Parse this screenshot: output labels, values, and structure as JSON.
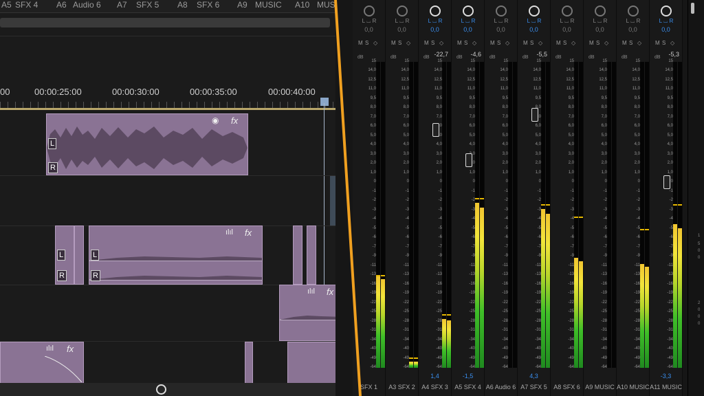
{
  "timeline": {
    "track_tabs": [
      {
        "num": "A5",
        "name": "SFX 4"
      },
      {
        "num": "A6",
        "name": "Audio 6"
      },
      {
        "num": "A7",
        "name": "SFX 5"
      },
      {
        "num": "A8",
        "name": "SFX 6"
      },
      {
        "num": "A9",
        "name": "MUSIC"
      },
      {
        "num": "A10",
        "name": "MUSIC"
      }
    ],
    "timecodes": [
      "00",
      "00:00:25:00",
      "00:00:30:00",
      "00:00:35:00",
      "00:00:40:00"
    ],
    "clip_labels": {
      "left": "L",
      "right": "R"
    },
    "fx_label": "fx",
    "scrollbar_icon": "scroll-handle-icon"
  },
  "mixer": {
    "db_label": "dB",
    "scale": [
      "15",
      "14,0",
      "12,5",
      "11,0",
      "9,5",
      "8,0",
      "7,0",
      "6,0",
      "5,0",
      "4,0",
      "3,0",
      "2,0",
      "1,0",
      "0",
      "-1",
      "-2",
      "-3",
      "-4",
      "-5",
      "-6",
      "-7",
      "-9",
      "-11",
      "-13",
      "-16",
      "-19",
      "-22",
      "-25",
      "-28",
      "-31",
      "-34",
      "-40",
      "-49",
      "-64"
    ],
    "channels": [
      {
        "pan": "0,0",
        "peak": "",
        "level": 0.3,
        "peak_line": 0.3,
        "fader": -1,
        "bottom": "",
        "num": "",
        "name": "SFX 1",
        "active": false
      },
      {
        "pan": "0,0",
        "peak": "",
        "level": 0.02,
        "peak_line": 0.03,
        "fader": -1,
        "bottom": "",
        "num": "A3",
        "name": "SFX 2",
        "active": false
      },
      {
        "pan": "0,0",
        "peak": "-22,7",
        "level": 0.16,
        "peak_line": 0.17,
        "fader": 0.78,
        "bottom": "1,4",
        "num": "A4",
        "name": "SFX 3",
        "active": true
      },
      {
        "pan": "0,0",
        "peak": "-4,6",
        "level": 0.54,
        "peak_line": 0.55,
        "fader": 0.68,
        "bottom": "-1,5",
        "num": "A5",
        "name": "SFX 4",
        "active": true
      },
      {
        "pan": "0,0",
        "peak": "",
        "level": 0.0,
        "peak_line": 0.0,
        "fader": -1,
        "bottom": "",
        "num": "A6",
        "name": "Audio 6",
        "active": false
      },
      {
        "pan": "0,0",
        "peak": "-5,5",
        "level": 0.52,
        "peak_line": 0.53,
        "fader": 0.83,
        "bottom": "4,3",
        "num": "A7",
        "name": "SFX 5",
        "active": true
      },
      {
        "pan": "0,0",
        "peak": "",
        "level": 0.36,
        "peak_line": 0.49,
        "fader": -1,
        "bottom": "",
        "num": "A8",
        "name": "SFX 6",
        "active": false
      },
      {
        "pan": "0,0",
        "peak": "",
        "level": 0.0,
        "peak_line": 0.0,
        "fader": -1,
        "bottom": "",
        "num": "A9",
        "name": "MUSIC",
        "active": false
      },
      {
        "pan": "0,0",
        "peak": "",
        "level": 0.34,
        "peak_line": 0.45,
        "fader": -1,
        "bottom": "",
        "num": "A10",
        "name": "MUSIC",
        "active": false
      },
      {
        "pan": "0,0",
        "peak": "-5,3",
        "level": 0.47,
        "peak_line": 0.53,
        "fader": 0.61,
        "bottom": "-3,3",
        "num": "A11",
        "name": "MUSIC",
        "active": true
      }
    ],
    "ms_labels": [
      "M",
      "S"
    ],
    "right_ruler": [
      "1",
      "5",
      "0",
      "0",
      "2",
      "0",
      "0",
      "0"
    ]
  },
  "colors": {
    "accent": "#3a8ff0",
    "clip": "#8a7394",
    "divider": "#f0a020"
  }
}
